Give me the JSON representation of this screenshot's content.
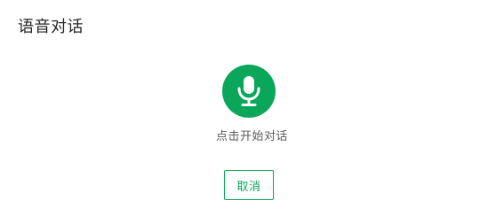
{
  "dialog": {
    "title": "语音对话",
    "mic_icon": "microphone-icon",
    "hint": "点击开始对话",
    "cancel_label": "取消"
  },
  "colors": {
    "accent": "#0aa65a",
    "title_text": "#262626",
    "hint_text": "#5a5a5a",
    "background": "#ffffff"
  }
}
